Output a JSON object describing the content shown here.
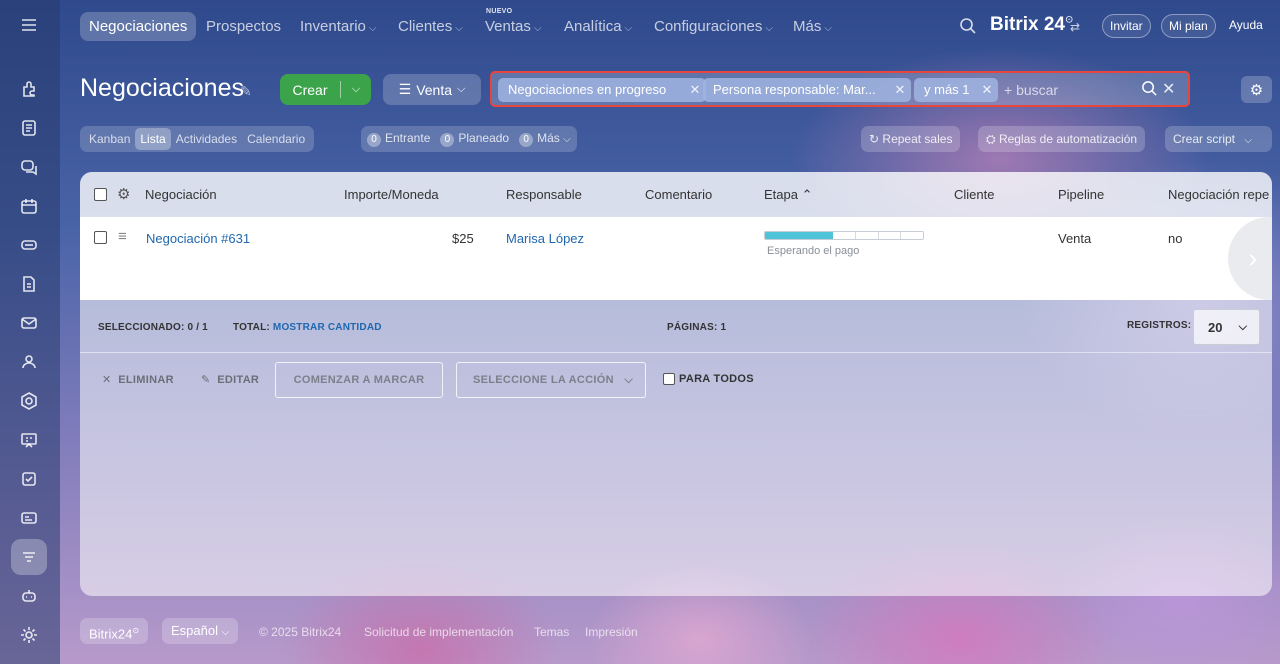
{
  "nav": {
    "items": [
      "Negociaciones",
      "Prospectos",
      "Inventario",
      "Clientes",
      "Ventas",
      "Analítica",
      "Configuraciones",
      "Más"
    ],
    "new_badge": "NUEVO",
    "brand": "Bitrix 24",
    "brand_mark": "⊙",
    "invite": "Invitar",
    "plan": "Mi plan",
    "help": "Ayuda"
  },
  "page": {
    "title": "Negociaciones",
    "create_label": "Crear",
    "pipeline_label": "Venta"
  },
  "filter": {
    "chips": [
      "Negociaciones en progreso",
      "Persona responsable: Mar...",
      "y más 1"
    ],
    "placeholder": "+ buscar"
  },
  "views": {
    "tabs": [
      "Kanban",
      "Lista",
      "Actividades",
      "Calendario"
    ],
    "counters": [
      {
        "count": "0",
        "label": "Entrante"
      },
      {
        "count": "0",
        "label": "Planeado"
      },
      {
        "count": "0",
        "label": "Más"
      }
    ],
    "repeat_sales": "Repeat sales",
    "automation": "Reglas de automatización",
    "script": "Crear script"
  },
  "grid": {
    "columns": [
      "Negociación",
      "Importe/Moneda",
      "Responsable",
      "Comentario",
      "Etapa",
      "Cliente",
      "Pipeline",
      "Negociación repe"
    ],
    "sort_indicator": "⌃",
    "rows": [
      {
        "deal": "Negociación #631",
        "amount": "$25",
        "responsible": "Marisa López",
        "stage_label": "Esperando el pago",
        "stage_progress": 0.43,
        "pipeline": "Venta",
        "repeat": "no"
      }
    ]
  },
  "footer": {
    "selected_label": "SELECCIONADO:",
    "selected_value": "0 / 1",
    "total_label": "TOTAL:",
    "total_link": "MOSTRAR CANTIDAD",
    "pages_label": "PÁGINAS:",
    "pages_value": "1",
    "records_label": "REGISTROS:",
    "records_value": "20"
  },
  "actions": {
    "delete": "ELIMINAR",
    "edit": "EDITAR",
    "start_marking": "COMENZAR A MARCAR",
    "select_action": "SELECCIONE LA ACCIÓN",
    "for_all": "PARA TODOS"
  },
  "bottom": {
    "brand": "Bitrix24",
    "brand_mark": "⊙",
    "language": "Español",
    "copyright": "© 2025 Bitrix24",
    "implementation": "Solicitud de implementación",
    "themes": "Temas",
    "print": "Impresión"
  }
}
